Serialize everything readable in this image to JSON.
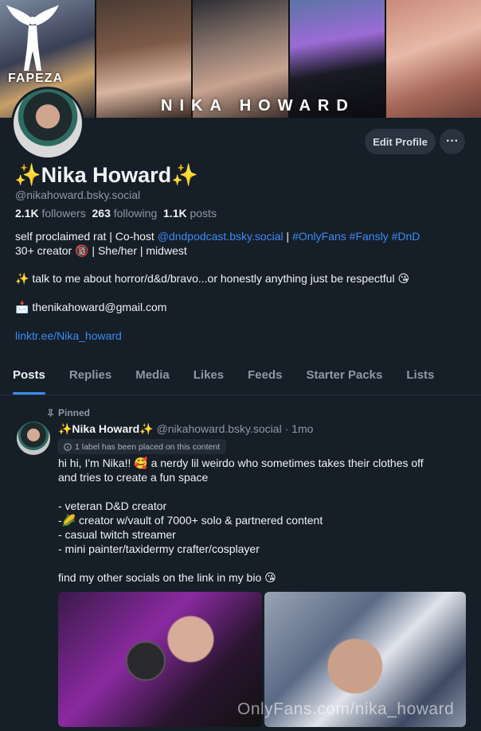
{
  "banner": {
    "logo_text": "FAPEZA",
    "title": "NIKA HOWARD"
  },
  "header": {
    "edit_profile_label": "Edit Profile",
    "more_label": "···"
  },
  "profile": {
    "display_name": "✨Nika Howard✨",
    "handle": "@nikahoward.bsky.social",
    "followers_count": "2.1K",
    "followers_label": "followers",
    "following_count": "263",
    "following_label": "following",
    "posts_count": "1.1K",
    "posts_label": "posts",
    "bio": {
      "line1_a": "self proclaimed rat | Co-host ",
      "line1_link": "@dndpodcast.bsky.social",
      "line1_b": " |  ",
      "line1_tags": "#OnlyFans #Fansly #DnD",
      "line2": "30+ creator 🔞 | She/her | midwest",
      "line3": "✨ talk to me about horror/d&d/bravo...or honestly anything just be respectful 😘",
      "line4": "📩 thenikahoward@gmail.com",
      "line5_link": "linktr.ee/Nika_howard"
    }
  },
  "tabs": [
    {
      "label": "Posts"
    },
    {
      "label": "Replies"
    },
    {
      "label": "Media"
    },
    {
      "label": "Likes"
    },
    {
      "label": "Feeds"
    },
    {
      "label": "Starter Packs"
    },
    {
      "label": "Lists"
    }
  ],
  "post": {
    "pinned_label": "Pinned",
    "author_name": "✨Nika Howard✨",
    "author_handle": "@nikahoward.bsky.social",
    "separator": " · ",
    "time": "1mo",
    "label_notice": "1 label has been placed on this content",
    "lines": [
      "hi hi, I'm Nika!! 🥰 a nerdy lil weirdo who sometimes takes their clothes off",
      "and tries to create a fun space",
      "",
      "- veteran D&D creator",
      "-🌽 creator w/vault of 7000+ solo & partnered content",
      "- casual twitch streamer",
      "- mini painter/taxidermy crafter/cosplayer",
      "",
      "find my other socials on the link in my bio 😘"
    ],
    "watermark": "OnlyFans.com/nika_howard"
  },
  "colors": {
    "background": "#161e27",
    "accent": "#3b8cf5",
    "muted": "#8e99a6"
  }
}
